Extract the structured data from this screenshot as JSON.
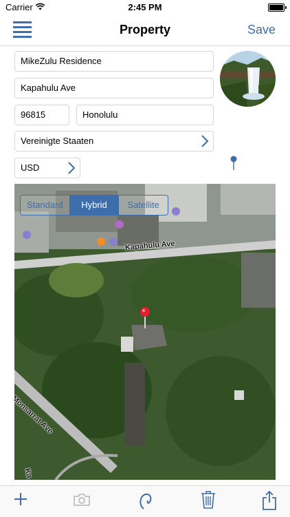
{
  "status_bar": {
    "carrier": "Carrier",
    "time": "2:45 PM"
  },
  "nav": {
    "title": "Property",
    "save_label": "Save"
  },
  "form": {
    "name": "MikeZulu Residence",
    "street": "Kapahulu Ave",
    "zip": "96815",
    "city": "Honolulu",
    "country": "Vereinigte Staaten",
    "currency": "USD"
  },
  "map": {
    "map_types": [
      "Standard",
      "Hybrid",
      "Satellite"
    ],
    "selected_map_type": "Hybrid",
    "street_labels": [
      "Kapahulu Ave",
      "Monsarrat Ave",
      "Ka"
    ]
  },
  "toolbar": {
    "icons": [
      "add-icon",
      "camera-icon",
      "lasso-icon",
      "trash-icon",
      "share-icon"
    ]
  },
  "colors": {
    "accent": "#3e6dab",
    "pin": "#e0202a"
  }
}
